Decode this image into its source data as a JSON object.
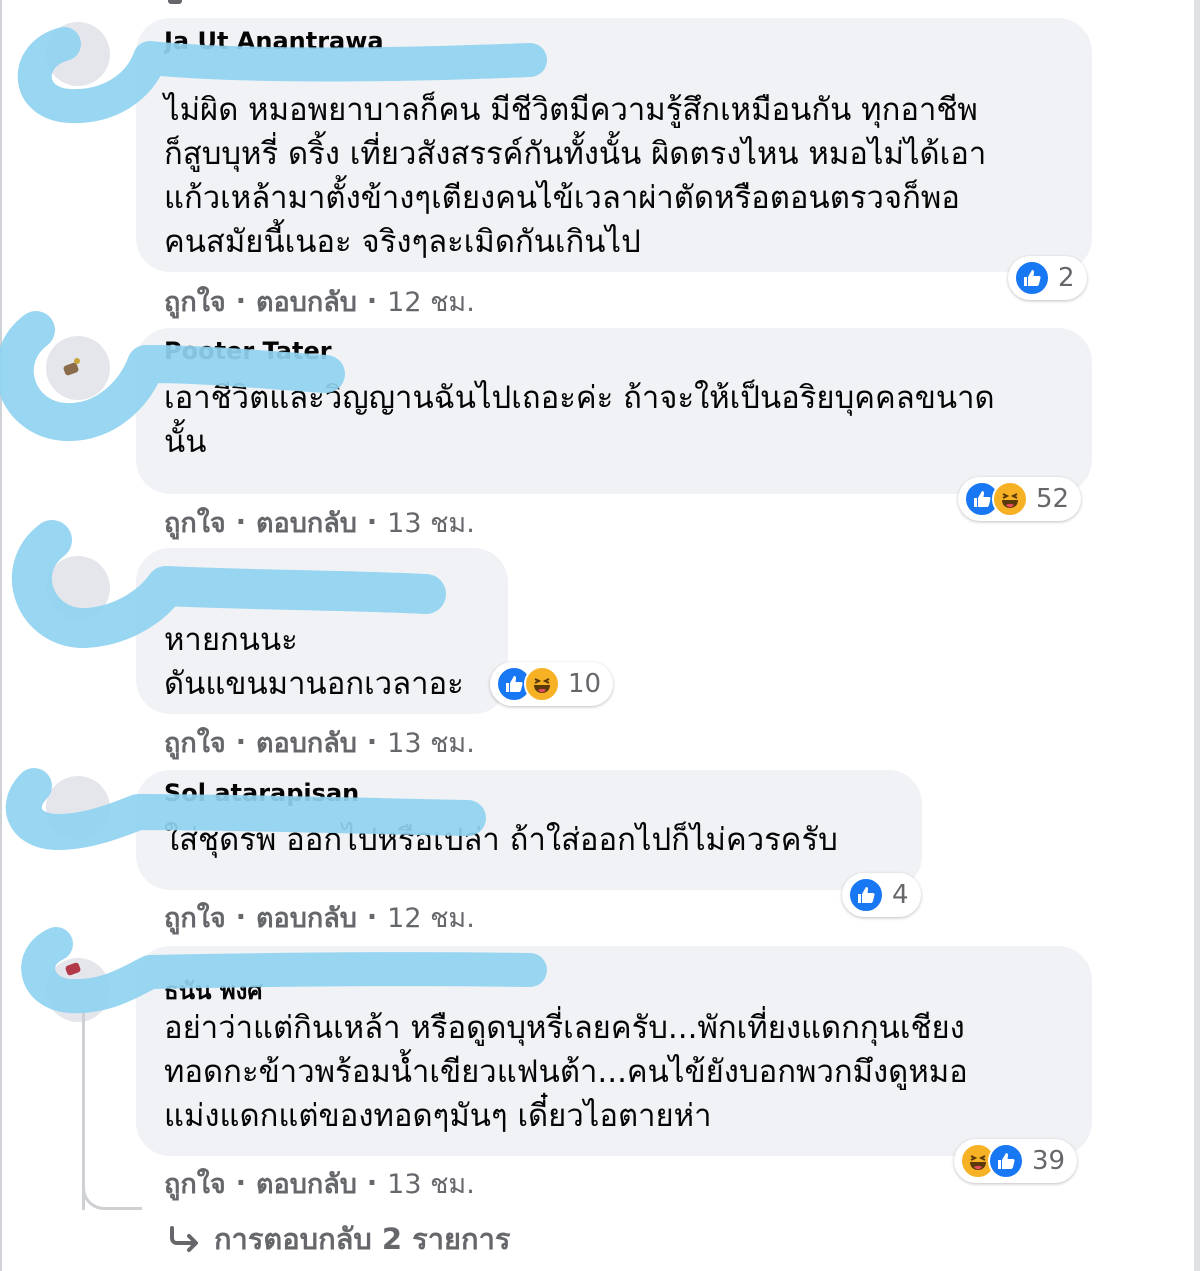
{
  "comments": [
    {
      "author": "Ja Ut Anantrawa",
      "text": "ไม่ผิด หมอพยาบาลก็คน มีชีวิตมีความรู้สึกเหมือนกัน ทุกอาชีพ\nก็สูบบุหรี่ ดริ้ง เที่ยวสังสรรค์กันทั้งนั้น ผิดตรงไหน หมอไม่ได้เอา\nแก้วเหล้ามาตั้งข้างๆเตียงคนไข้เวลาผ่าตัดหรือตอนตรวจก็พอ\nคนสมัยนี้เนอะ จริงๆละเมิดกันเกินไป",
      "reaction_types": [
        "like"
      ],
      "reaction_count": "2",
      "like_label": "ถูกใจ",
      "reply_label": "ตอบกลับ",
      "time": "12 ชม."
    },
    {
      "author": "Pooter Tater",
      "text": "เอาชีวิตและวิญญานฉันไปเถอะค่ะ ถ้าจะให้เป็นอริยบุคคลขนาด\nนั้น",
      "reaction_types": [
        "like",
        "haha"
      ],
      "reaction_count": "52",
      "like_label": "ถูกใจ",
      "reply_label": "ตอบกลับ",
      "time": "13 ชม."
    },
    {
      "author": "",
      "text": "หายกนนะ\nดันแขนมานอกเวลาอะ",
      "reaction_types": [
        "like",
        "haha"
      ],
      "reaction_count": "10",
      "like_label": "ถูกใจ",
      "reply_label": "ตอบกลับ",
      "time": "13 ชม."
    },
    {
      "author": "Sol atarapisan",
      "text": "ใส่ชุดรพ ออกไปหรือเปล่า ถ้าใส่ออกไปก็ไม่ควรครับ",
      "reaction_types": [
        "like"
      ],
      "reaction_count": "4",
      "like_label": "ถูกใจ",
      "reply_label": "ตอบกลับ",
      "time": "12 ชม."
    },
    {
      "author": "ธนัน พงศ",
      "text": "อย่าว่าแต่กินเหล้า หรือดูดบุหรี่เลยครับ...พักเที่ยงแดกกุนเชียง\nทอดกะข้าวพร้อมน้ำเขียวแฟนต้า...คนไข้ยังบอกพวกมึงดูหมอ\nแม่งแดกแต่ของทอดๆมันๆ เดี๋ยวไอตายห่า",
      "reaction_types": [
        "haha",
        "like"
      ],
      "reaction_count": "39",
      "like_label": "ถูกใจ",
      "reply_label": "ตอบกลับ",
      "time": "13 ชม."
    }
  ],
  "replies_link": "การตอบกลับ 2 รายการ",
  "colors": {
    "bubble": "#f0f2f5",
    "text": "#050505",
    "meta": "#65676b",
    "like": "#1877f2",
    "haha": "#f7b125",
    "scribble": "#8fd3f0"
  },
  "icons": [
    "like-reaction-icon",
    "haha-reaction-icon",
    "reply-arrow-icon"
  ]
}
